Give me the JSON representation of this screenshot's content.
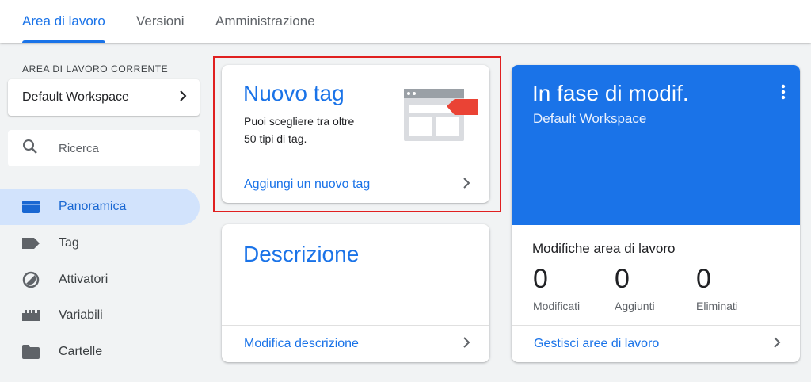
{
  "tabs": [
    {
      "label": "Area di lavoro",
      "active": true
    },
    {
      "label": "Versioni",
      "active": false
    },
    {
      "label": "Amministrazione",
      "active": false
    }
  ],
  "sidebar": {
    "workspace_label": "AREA DI LAVORO CORRENTE",
    "workspace_name": "Default Workspace",
    "search_placeholder": "Ricerca",
    "items": [
      {
        "label": "Panoramica",
        "icon": "overview-icon",
        "active": true
      },
      {
        "label": "Tag",
        "icon": "tag-icon",
        "active": false
      },
      {
        "label": "Attivatori",
        "icon": "trigger-icon",
        "active": false
      },
      {
        "label": "Variabili",
        "icon": "variables-icon",
        "active": false
      },
      {
        "label": "Cartelle",
        "icon": "folder-icon",
        "active": false
      }
    ]
  },
  "new_tag_card": {
    "title": "Nuovo tag",
    "description_line1": "Puoi scegliere tra oltre",
    "description_line2": "50 tipi di tag.",
    "action": "Aggiungi un nuovo tag",
    "illustration": "tag-page-illustration"
  },
  "description_card": {
    "title": "Descrizione",
    "action": "Modifica descrizione"
  },
  "editing_card": {
    "title": "In fase di modif.",
    "subtitle": "Default Workspace",
    "changes_title": "Modifiche area di lavoro",
    "stats": [
      {
        "value": "0",
        "label": "Modificati"
      },
      {
        "value": "0",
        "label": "Aggiunti"
      },
      {
        "value": "0",
        "label": "Eliminati"
      }
    ],
    "action": "Gestisci aree di lavoro"
  },
  "colors": {
    "accent": "#1a73e8",
    "active_nav_bg": "#d2e3fc",
    "highlight": "#e02020",
    "tag_red": "#ea4335"
  }
}
